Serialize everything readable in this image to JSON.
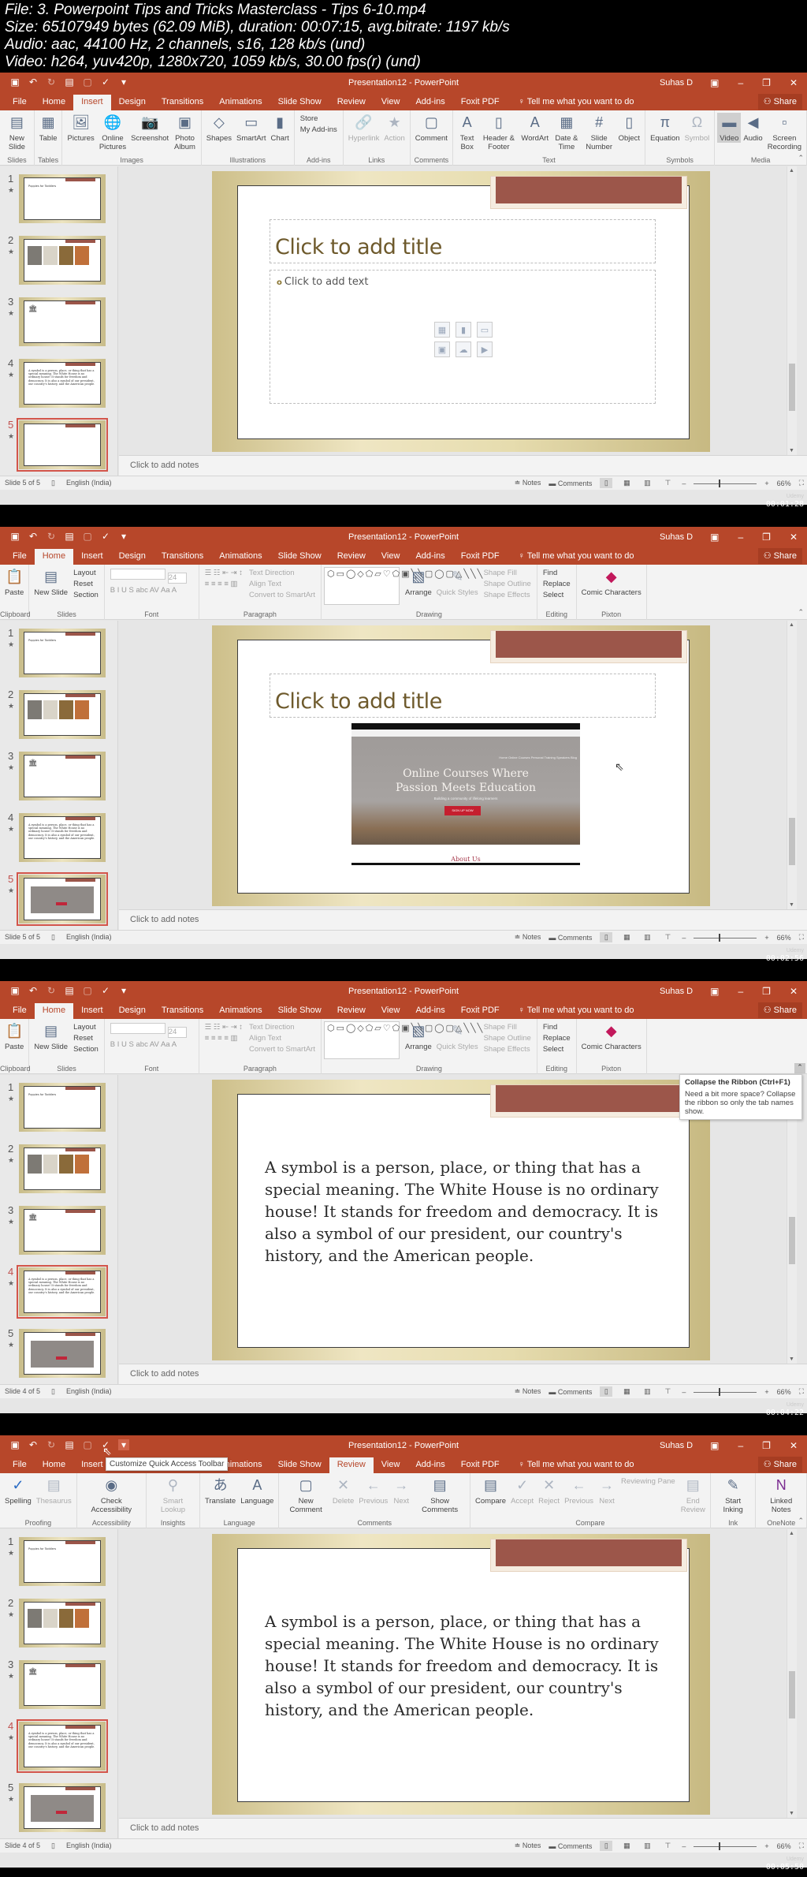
{
  "file_info": {
    "line1": "File: 3. Powerpoint Tips and Tricks Masterclass - Tips 6-10.mp4",
    "line2": "Size: 65107949 bytes (62.09 MiB), duration: 00:07:15, avg.bitrate: 1197 kb/s",
    "line3": "Audio: aac, 44100 Hz, 2 channels, s16, 128 kb/s (und)",
    "line4": "Video: h264, yuv420p, 1280x720, 1059 kb/s, 30.00 fps(r) (und)"
  },
  "app": {
    "window_title": "Presentation12 - PowerPoint",
    "user": "Suhas D",
    "share": "Share",
    "tell_me": "Tell me what you want to do",
    "tabs": [
      "File",
      "Home",
      "Insert",
      "Design",
      "Transitions",
      "Animations",
      "Slide Show",
      "Review",
      "View",
      "Add-ins",
      "Foxit PDF"
    ],
    "notes_placeholder": "Click to add notes",
    "language": "English (India)",
    "notes_btn": "Notes",
    "comments_btn": "Comments",
    "zoom": "66%",
    "watermark": "Udemy",
    "accent": "#b7472a"
  },
  "ribbons": {
    "insert": {
      "groups": [
        {
          "label": "Slides",
          "buttons": [
            "New Slide"
          ]
        },
        {
          "label": "Tables",
          "buttons": [
            "Table"
          ]
        },
        {
          "label": "Images",
          "buttons": [
            "Pictures",
            "Online Pictures",
            "Screenshot",
            "Photo Album"
          ]
        },
        {
          "label": "Illustrations",
          "buttons": [
            "Shapes",
            "SmartArt",
            "Chart"
          ]
        },
        {
          "label": "Add-ins",
          "buttons": [
            "Store",
            "My Add-ins"
          ]
        },
        {
          "label": "Links",
          "buttons": [
            "Hyperlink",
            "Action"
          ]
        },
        {
          "label": "Comments",
          "buttons": [
            "Comment"
          ]
        },
        {
          "label": "Text",
          "buttons": [
            "Text Box",
            "Header & Footer",
            "WordArt",
            "Date & Time",
            "Slide Number",
            "Object"
          ]
        },
        {
          "label": "Symbols",
          "buttons": [
            "Equation",
            "Symbol"
          ]
        },
        {
          "label": "Media",
          "buttons": [
            "Video",
            "Audio",
            "Screen Recording"
          ]
        }
      ]
    },
    "home": {
      "groups": [
        {
          "label": "Clipboard",
          "buttons": [
            "Paste"
          ]
        },
        {
          "label": "Slides",
          "buttons": [
            "New Slide",
            "Layout",
            "Reset",
            "Section"
          ]
        },
        {
          "label": "Font",
          "font_size": "24"
        },
        {
          "label": "Paragraph",
          "buttons": [
            "Text Direction",
            "Align Text",
            "Convert to SmartArt"
          ]
        },
        {
          "label": "Drawing",
          "buttons": [
            "Arrange",
            "Quick Styles",
            "Shape Fill",
            "Shape Outline",
            "Shape Effects"
          ]
        },
        {
          "label": "Editing",
          "buttons": [
            "Find",
            "Replace",
            "Select"
          ]
        },
        {
          "label": "Pixton",
          "buttons": [
            "Comic Characters"
          ]
        }
      ]
    },
    "review": {
      "groups": [
        {
          "label": "Proofing",
          "buttons": [
            "Spelling",
            "Thesaurus"
          ]
        },
        {
          "label": "Accessibility",
          "buttons": [
            "Check Accessibility"
          ]
        },
        {
          "label": "Insights",
          "buttons": [
            "Smart Lookup"
          ]
        },
        {
          "label": "Language",
          "buttons": [
            "Translate",
            "Language"
          ]
        },
        {
          "label": "Comments",
          "buttons": [
            "New Comment",
            "Delete",
            "Previous",
            "Next",
            "Show Comments"
          ]
        },
        {
          "label": "Compare",
          "buttons": [
            "Compare",
            "Accept",
            "Reject",
            "Previous",
            "Next",
            "Reviewing Pane",
            "End Review"
          ]
        },
        {
          "label": "Ink",
          "buttons": [
            "Start Inking"
          ]
        },
        {
          "label": "OneNote",
          "buttons": [
            "Linked Notes"
          ]
        }
      ]
    }
  },
  "slides": {
    "title_placeholder": "Click to add title",
    "text_placeholder": "Click to add text",
    "slide4_text": "A symbol is a person, place, or thing that has a special meaning. The White House is no ordinary house! It stands for freedom and democracy. It is also a symbol of our president, our country's history, and the American people.",
    "web_heading_1": "Online Courses Where",
    "web_heading_2": "Passion Meets Education",
    "web_sub": "Building a community of lifelong learners",
    "web_cta": "SIGN UP NOW",
    "web_about": "About Us",
    "thumb1_title": "Puppies for Toddlers",
    "numbers": [
      "1",
      "2",
      "3",
      "4",
      "5"
    ]
  },
  "frames": [
    {
      "active_tab": "Insert",
      "status": "Slide 5 of 5",
      "timestamp": "00:01:28",
      "selected_slide": 5
    },
    {
      "active_tab": "Home",
      "status": "Slide 5 of 5",
      "timestamp": "00:02:56",
      "selected_slide": 5
    },
    {
      "active_tab": "Home",
      "status": "Slide 4 of 5",
      "timestamp": "00:04:22",
      "selected_slide": 4,
      "tooltip_title": "Collapse the Ribbon (Ctrl+F1)",
      "tooltip_body": "Need a bit more space? Collapse the ribbon so only the tab names show."
    },
    {
      "active_tab": "Review",
      "status": "Slide 4 of 5",
      "timestamp": "00:05:50",
      "selected_slide": 4,
      "tooltip": "Customize Quick Access Toolbar"
    }
  ]
}
